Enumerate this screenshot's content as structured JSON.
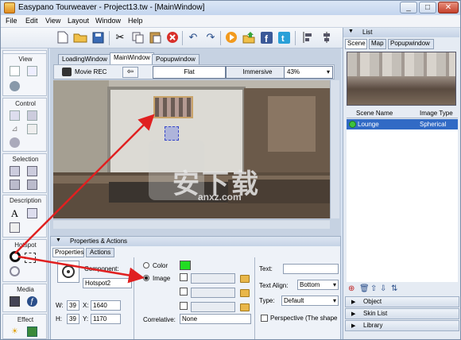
{
  "window": {
    "title": "Easypano Tourweaver - Project13.tw - [MainWindow]",
    "controls": [
      "_",
      "□",
      "✕"
    ]
  },
  "menubar": [
    "File",
    "Edit",
    "View",
    "Layout",
    "Window",
    "Help"
  ],
  "toolbar": {
    "icons": [
      "new-icon",
      "open-icon",
      "save-icon",
      "cut-icon",
      "copy-icon",
      "paste-icon",
      "delete-icon",
      "undo-icon",
      "redo-icon",
      "play-icon",
      "publish-icon",
      "facebook-icon",
      "twitter-icon",
      "align-icon",
      "distribute-icon"
    ]
  },
  "left_sidebar": {
    "sections": [
      {
        "title": "View"
      },
      {
        "title": "Control"
      },
      {
        "title": "Selection"
      },
      {
        "title": "Description"
      },
      {
        "title": "Hotspot"
      },
      {
        "title": "Media"
      },
      {
        "title": "Effect"
      }
    ]
  },
  "center": {
    "tabs": [
      "LoadingWindow",
      "MainWindow",
      "Popupwindow"
    ],
    "active_tab": "MainWindow",
    "view_toolbar": {
      "movie_rec": "Movie REC",
      "flat": "Flat",
      "immersive": "Immersive",
      "zoom": "43%"
    },
    "hotspot_label": "安下载",
    "watermark": "anxz.com"
  },
  "properties": {
    "panel_title": "Properties & Actions",
    "tabs": [
      "Properties",
      "Actions"
    ],
    "component_label": "Component:",
    "component_value": "Hotspot2",
    "w_label": "W:",
    "w_value": "39",
    "h_label": "H:",
    "h_value": "39",
    "x_label": "X:",
    "x_value": "1640",
    "y_label": "Y:",
    "y_value": "1170",
    "color_label": "Color",
    "image_label": "Image",
    "correlative_label": "Correlative:",
    "correlative_value": "None",
    "text_label": "Text:",
    "text_align_label": "Text Align:",
    "text_align_value": "Bottom",
    "type_label": "Type:",
    "type_value": "Default",
    "perspective_label": "Perspective (The shape"
  },
  "right_panel": {
    "list_title": "List",
    "tabs": [
      "Scene",
      "Map",
      "Popupwindow"
    ],
    "columns": [
      "Scene Name",
      "Image Type"
    ],
    "rows": [
      {
        "name": "Lounge",
        "type": "Spherical"
      }
    ],
    "accordions": [
      "Object",
      "Skin List",
      "Library"
    ]
  },
  "colors": {
    "accent_blue": "#316ac5",
    "color_swatch": "#22dd22",
    "arrow_red": "#e02020"
  }
}
